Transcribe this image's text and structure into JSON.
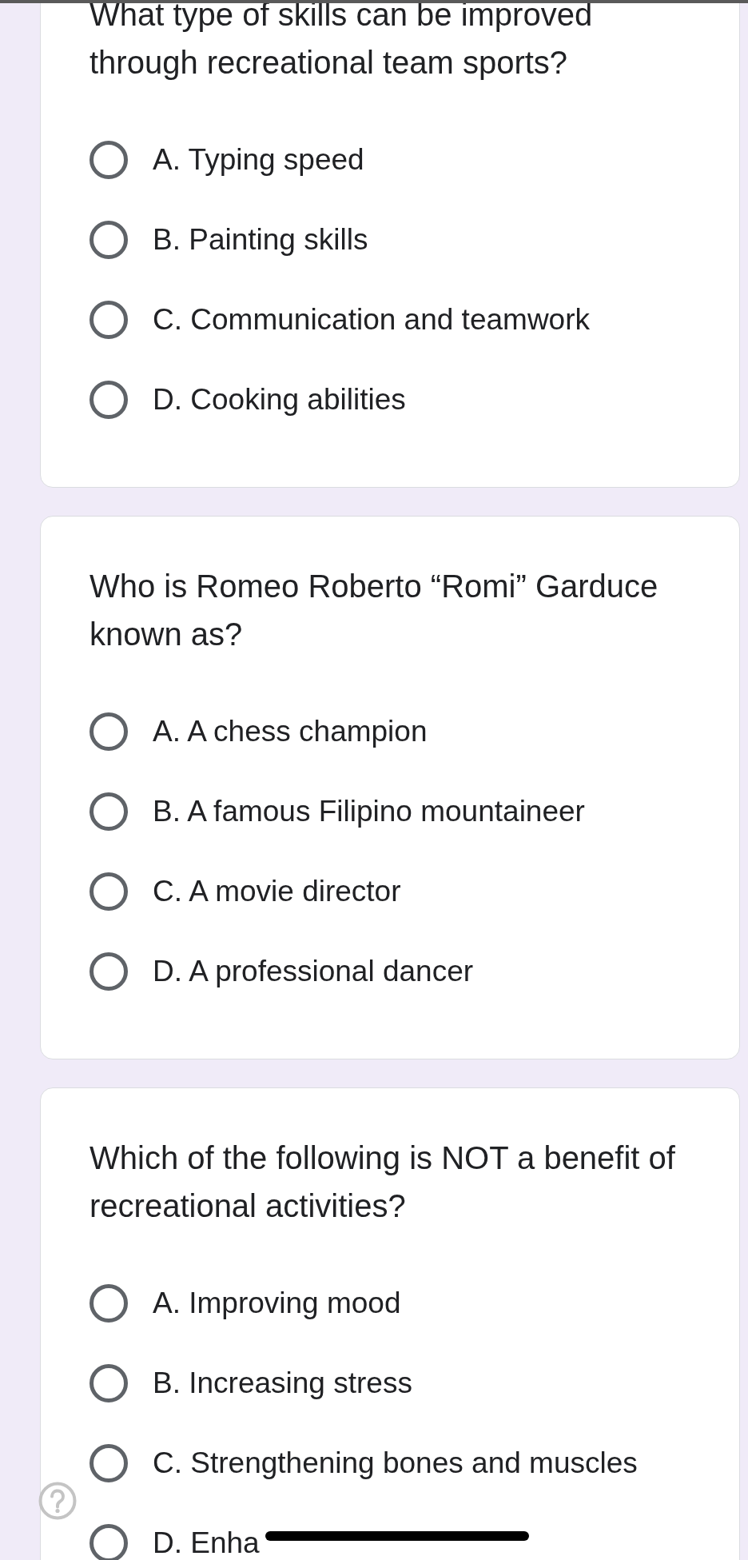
{
  "questions": [
    {
      "text": "What type of skills can be improved through recreational team sports?",
      "options": [
        {
          "label": "A. Typing speed",
          "selected": false
        },
        {
          "label": "B. Painting skills",
          "selected": false
        },
        {
          "label": "C. Communication and teamwork",
          "selected": false
        },
        {
          "label": "D. Cooking abilities",
          "selected": false
        }
      ]
    },
    {
      "text": "Who is Romeo Roberto “Romi” Garduce known as?",
      "options": [
        {
          "label": "A. A chess champion",
          "selected": false
        },
        {
          "label": "B. A famous Filipino mountaineer",
          "selected": false
        },
        {
          "label": "C. A movie director",
          "selected": false
        },
        {
          "label": "D. A professional dancer",
          "selected": false
        }
      ]
    },
    {
      "text": "Which of the following is NOT a benefit of recreational activities?",
      "options": [
        {
          "label": "A. Improving mood",
          "selected": false
        },
        {
          "label": "B. Increasing stress",
          "selected": false
        },
        {
          "label": "C. Strengthening bones and muscles",
          "selected": false
        },
        {
          "label": "D. Enha",
          "selected": false
        }
      ]
    }
  ]
}
